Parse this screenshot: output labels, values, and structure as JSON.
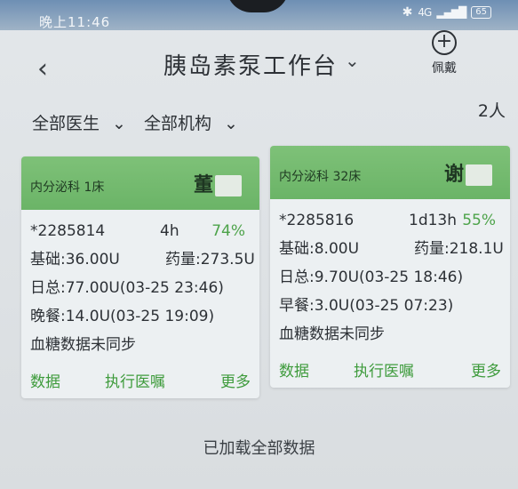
{
  "status_bar": {
    "time": "晚上11:46",
    "bluetooth_icon": "bluetooth-icon",
    "signal": "4G",
    "battery": "65"
  },
  "header": {
    "back_icon": "chevron-left-icon",
    "title": "胰岛素泵工作台",
    "title_chevron": "chevron-down-icon",
    "wear_label": "佩戴"
  },
  "filters": {
    "doctors": "全部医生",
    "institutions": "全部机构",
    "count": "2人"
  },
  "cards": [
    {
      "ward": "内分泌科 1床",
      "name": "董",
      "id": "*2285814",
      "duration": "4h",
      "percent": "74%",
      "base": "基础:36.00U",
      "drug": "药量:273.5U",
      "daily": "日总:77.00U(03-25 23:46)",
      "meal": "晚餐:14.0U(03-25 19:09)",
      "glucose": "血糖数据未同步",
      "actions": [
        "数据",
        "执行医嘱",
        "更多"
      ]
    },
    {
      "ward": "内分泌科 32床",
      "name": "谢",
      "id": "*2285816",
      "duration": "1d13h",
      "percent": "55%",
      "base": "基础:8.00U",
      "drug": "药量:218.1U",
      "daily": "日总:9.70U(03-25 18:46)",
      "meal": "早餐:3.0U(03-25 07:23)",
      "glucose": "血糖数据未同步",
      "actions": [
        "数据",
        "执行医嘱",
        "更多"
      ]
    }
  ],
  "footer": {
    "loaded": "已加载全部数据"
  },
  "colors": {
    "card_header": "#6bb467",
    "accent_green": "#3e9b3c",
    "background": "#dde1e4"
  }
}
